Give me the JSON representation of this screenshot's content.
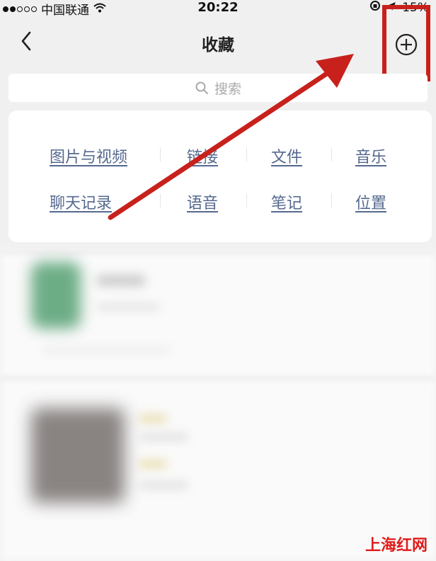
{
  "status_bar": {
    "carrier": "中国联通",
    "time": "20:22",
    "battery": "15%"
  },
  "nav": {
    "title": "收藏",
    "back_icon": "chevron-left-icon",
    "add_icon": "plus-circle-icon"
  },
  "search": {
    "placeholder": "搜索"
  },
  "categories": [
    [
      "图片与视频",
      "链接",
      "文件",
      "音乐"
    ],
    [
      "聊天记录",
      "语音",
      "笔记",
      "位置"
    ]
  ],
  "watermark": "上海红网",
  "colors": {
    "accent_link": "#55698f",
    "annotation_red": "#c8211c"
  }
}
